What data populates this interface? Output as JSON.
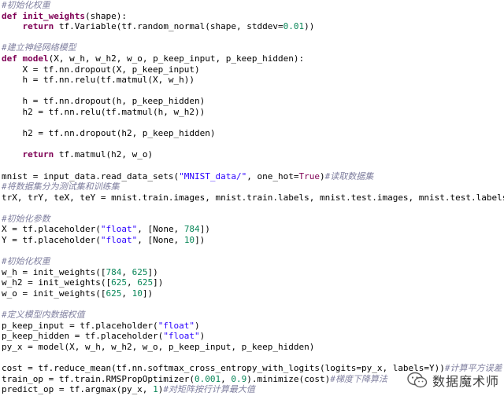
{
  "colors": {
    "background": "#ffffff",
    "comment": "#7f7f9f",
    "keyword": "#7f0055",
    "string": "#2a00ff",
    "number": "#098658",
    "default": "#000000"
  },
  "code": {
    "lines": [
      [
        {
          "t": "#初始化权重",
          "c": "cm"
        }
      ],
      [
        {
          "t": "def ",
          "c": "kw"
        },
        {
          "t": "init_weights",
          "c": "kw"
        },
        {
          "t": "(shape):"
        }
      ],
      [
        {
          "t": "    "
        },
        {
          "t": "return",
          "c": "kw"
        },
        {
          "t": " tf.Variable(tf.random_normal(shape, stddev="
        },
        {
          "t": "0.01",
          "c": "num"
        },
        {
          "t": "))"
        }
      ],
      [
        {
          "t": ""
        }
      ],
      [
        {
          "t": "#建立神经网络模型",
          "c": "cm"
        }
      ],
      [
        {
          "t": "def ",
          "c": "kw"
        },
        {
          "t": "model",
          "c": "kw"
        },
        {
          "t": "(X, w_h, w_h2, w_o, p_keep_input, p_keep_hidden):"
        }
      ],
      [
        {
          "t": "    X = tf.nn.dropout(X, p_keep_input)"
        }
      ],
      [
        {
          "t": "    h = tf.nn.relu(tf.matmul(X, w_h))"
        }
      ],
      [
        {
          "t": ""
        }
      ],
      [
        {
          "t": "    h = tf.nn.dropout(h, p_keep_hidden)"
        }
      ],
      [
        {
          "t": "    h2 = tf.nn.relu(tf.matmul(h, w_h2))"
        }
      ],
      [
        {
          "t": ""
        }
      ],
      [
        {
          "t": "    h2 = tf.nn.dropout(h2, p_keep_hidden)"
        }
      ],
      [
        {
          "t": ""
        }
      ],
      [
        {
          "t": "    "
        },
        {
          "t": "return",
          "c": "kw"
        },
        {
          "t": " tf.matmul(h2, w_o)"
        }
      ],
      [
        {
          "t": ""
        }
      ],
      [
        {
          "t": "mnist = input_data.read_data_sets("
        },
        {
          "t": "\"MNIST_data/\"",
          "c": "str"
        },
        {
          "t": ", one_hot="
        },
        {
          "t": "True",
          "c": "cv"
        },
        {
          "t": ")"
        },
        {
          "t": "#读取数据集",
          "c": "cm"
        }
      ],
      [
        {
          "t": "#将数据集分为测试集和训练集",
          "c": "cm"
        }
      ],
      [
        {
          "t": "trX, trY, teX, teY = mnist.train.images, mnist.train.labels, mnist.test.images, mnist.test.labels"
        }
      ],
      [
        {
          "t": ""
        }
      ],
      [
        {
          "t": "#初始化参数",
          "c": "cm"
        }
      ],
      [
        {
          "t": "X = tf.placeholder("
        },
        {
          "t": "\"float\"",
          "c": "str"
        },
        {
          "t": ", [None, "
        },
        {
          "t": "784",
          "c": "num"
        },
        {
          "t": "])"
        }
      ],
      [
        {
          "t": "Y = tf.placeholder("
        },
        {
          "t": "\"float\"",
          "c": "str"
        },
        {
          "t": ", [None, "
        },
        {
          "t": "10",
          "c": "num"
        },
        {
          "t": "])"
        }
      ],
      [
        {
          "t": ""
        }
      ],
      [
        {
          "t": "#初始化权重",
          "c": "cm"
        }
      ],
      [
        {
          "t": "w_h = init_weights(["
        },
        {
          "t": "784",
          "c": "num"
        },
        {
          "t": ", "
        },
        {
          "t": "625",
          "c": "num"
        },
        {
          "t": "])"
        }
      ],
      [
        {
          "t": "w_h2 = init_weights(["
        },
        {
          "t": "625",
          "c": "num"
        },
        {
          "t": ", "
        },
        {
          "t": "625",
          "c": "num"
        },
        {
          "t": "])"
        }
      ],
      [
        {
          "t": "w_o = init_weights(["
        },
        {
          "t": "625",
          "c": "num"
        },
        {
          "t": ", "
        },
        {
          "t": "10",
          "c": "num"
        },
        {
          "t": "])"
        }
      ],
      [
        {
          "t": ""
        }
      ],
      [
        {
          "t": "#定义模型内数据权值",
          "c": "cm"
        }
      ],
      [
        {
          "t": "p_keep_input = tf.placeholder("
        },
        {
          "t": "\"float\"",
          "c": "str"
        },
        {
          "t": ")"
        }
      ],
      [
        {
          "t": "p_keep_hidden = tf.placeholder("
        },
        {
          "t": "\"float\"",
          "c": "str"
        },
        {
          "t": ")"
        }
      ],
      [
        {
          "t": "py_x = model(X, w_h, w_h2, w_o, p_keep_input, p_keep_hidden)"
        }
      ],
      [
        {
          "t": ""
        }
      ],
      [
        {
          "t": "cost = tf.reduce_mean(tf.nn.softmax_cross_entropy_with_logits(logits=py_x, labels=Y))"
        },
        {
          "t": "#计算平方误差",
          "c": "cm"
        }
      ],
      [
        {
          "t": "train_op = tf.train.RMSPropOptimizer("
        },
        {
          "t": "0.001",
          "c": "num"
        },
        {
          "t": ", "
        },
        {
          "t": "0.9",
          "c": "num"
        },
        {
          "t": ").minimize(cost)"
        },
        {
          "t": "#梯度下降算法",
          "c": "cm"
        }
      ],
      [
        {
          "t": "predict_op = tf.argmax(py_x, "
        },
        {
          "t": "1",
          "c": "num"
        },
        {
          "t": ")"
        },
        {
          "t": "#对矩阵按行计算最大值",
          "c": "cm"
        }
      ]
    ]
  },
  "watermark": {
    "text": "数据魔术师",
    "icon": "wechat-icon"
  }
}
